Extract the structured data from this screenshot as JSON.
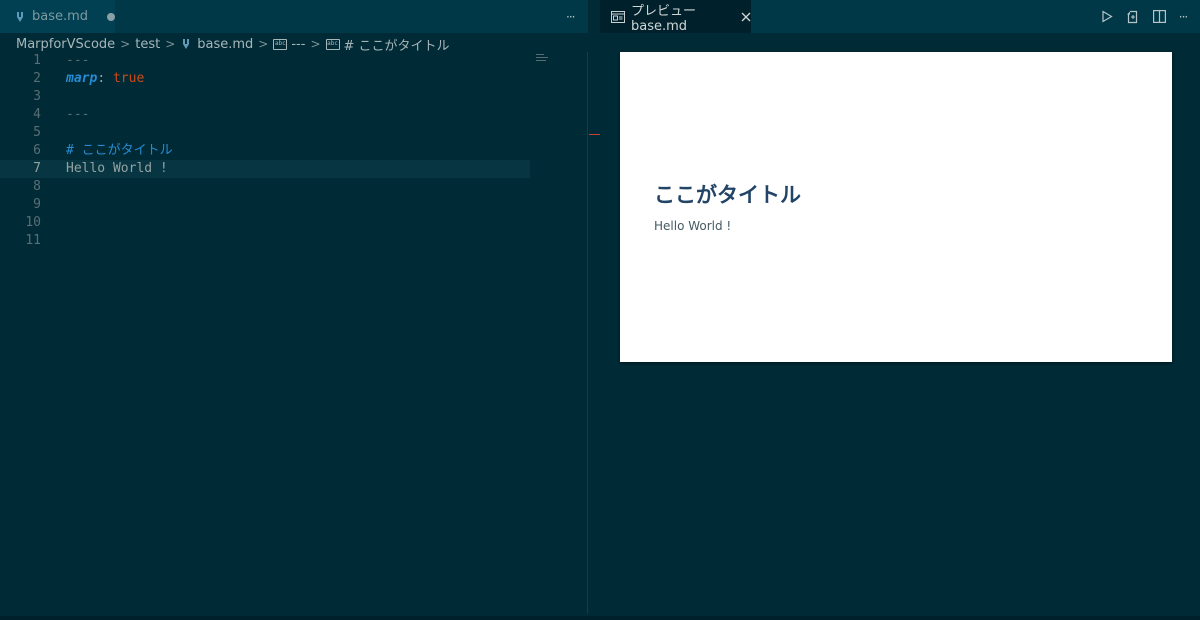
{
  "left_editor": {
    "tab": {
      "label": "base.md",
      "icon": "markdown-icon",
      "dirty": true
    },
    "more_actions": "···",
    "breadcrumb": {
      "folder": "MarpforVScode",
      "subfolder": "test",
      "file": "base.md",
      "symbol1": "---",
      "symbol2": "# ここがタイトル"
    },
    "lines": [
      {
        "num": "1",
        "text": "---"
      },
      {
        "num": "2",
        "key": "marp",
        "punct": ":",
        "value": "true"
      },
      {
        "num": "3",
        "text": ""
      },
      {
        "num": "4",
        "text": "---"
      },
      {
        "num": "5",
        "text": ""
      },
      {
        "num": "6",
        "heading": "# ここがタイトル"
      },
      {
        "num": "7",
        "text": "Hello World !"
      },
      {
        "num": "8",
        "text": ""
      },
      {
        "num": "9",
        "text": ""
      },
      {
        "num": "10",
        "text": ""
      },
      {
        "num": "11",
        "text": ""
      }
    ],
    "current_line": 7
  },
  "preview": {
    "tab": {
      "label": "プレビュー base.md",
      "icon": "preview-icon"
    },
    "actions": [
      "run-icon",
      "open-changes-icon",
      "split-editor-icon"
    ],
    "more_actions": "···",
    "slide": {
      "title": "ここがタイトル",
      "body": "Hello World !"
    }
  },
  "colors": {
    "background": "#002b36",
    "tabbar": "#003847",
    "accent_blue": "#268bd2",
    "accent_orange": "#cb4b16",
    "slide_title": "#224466"
  }
}
